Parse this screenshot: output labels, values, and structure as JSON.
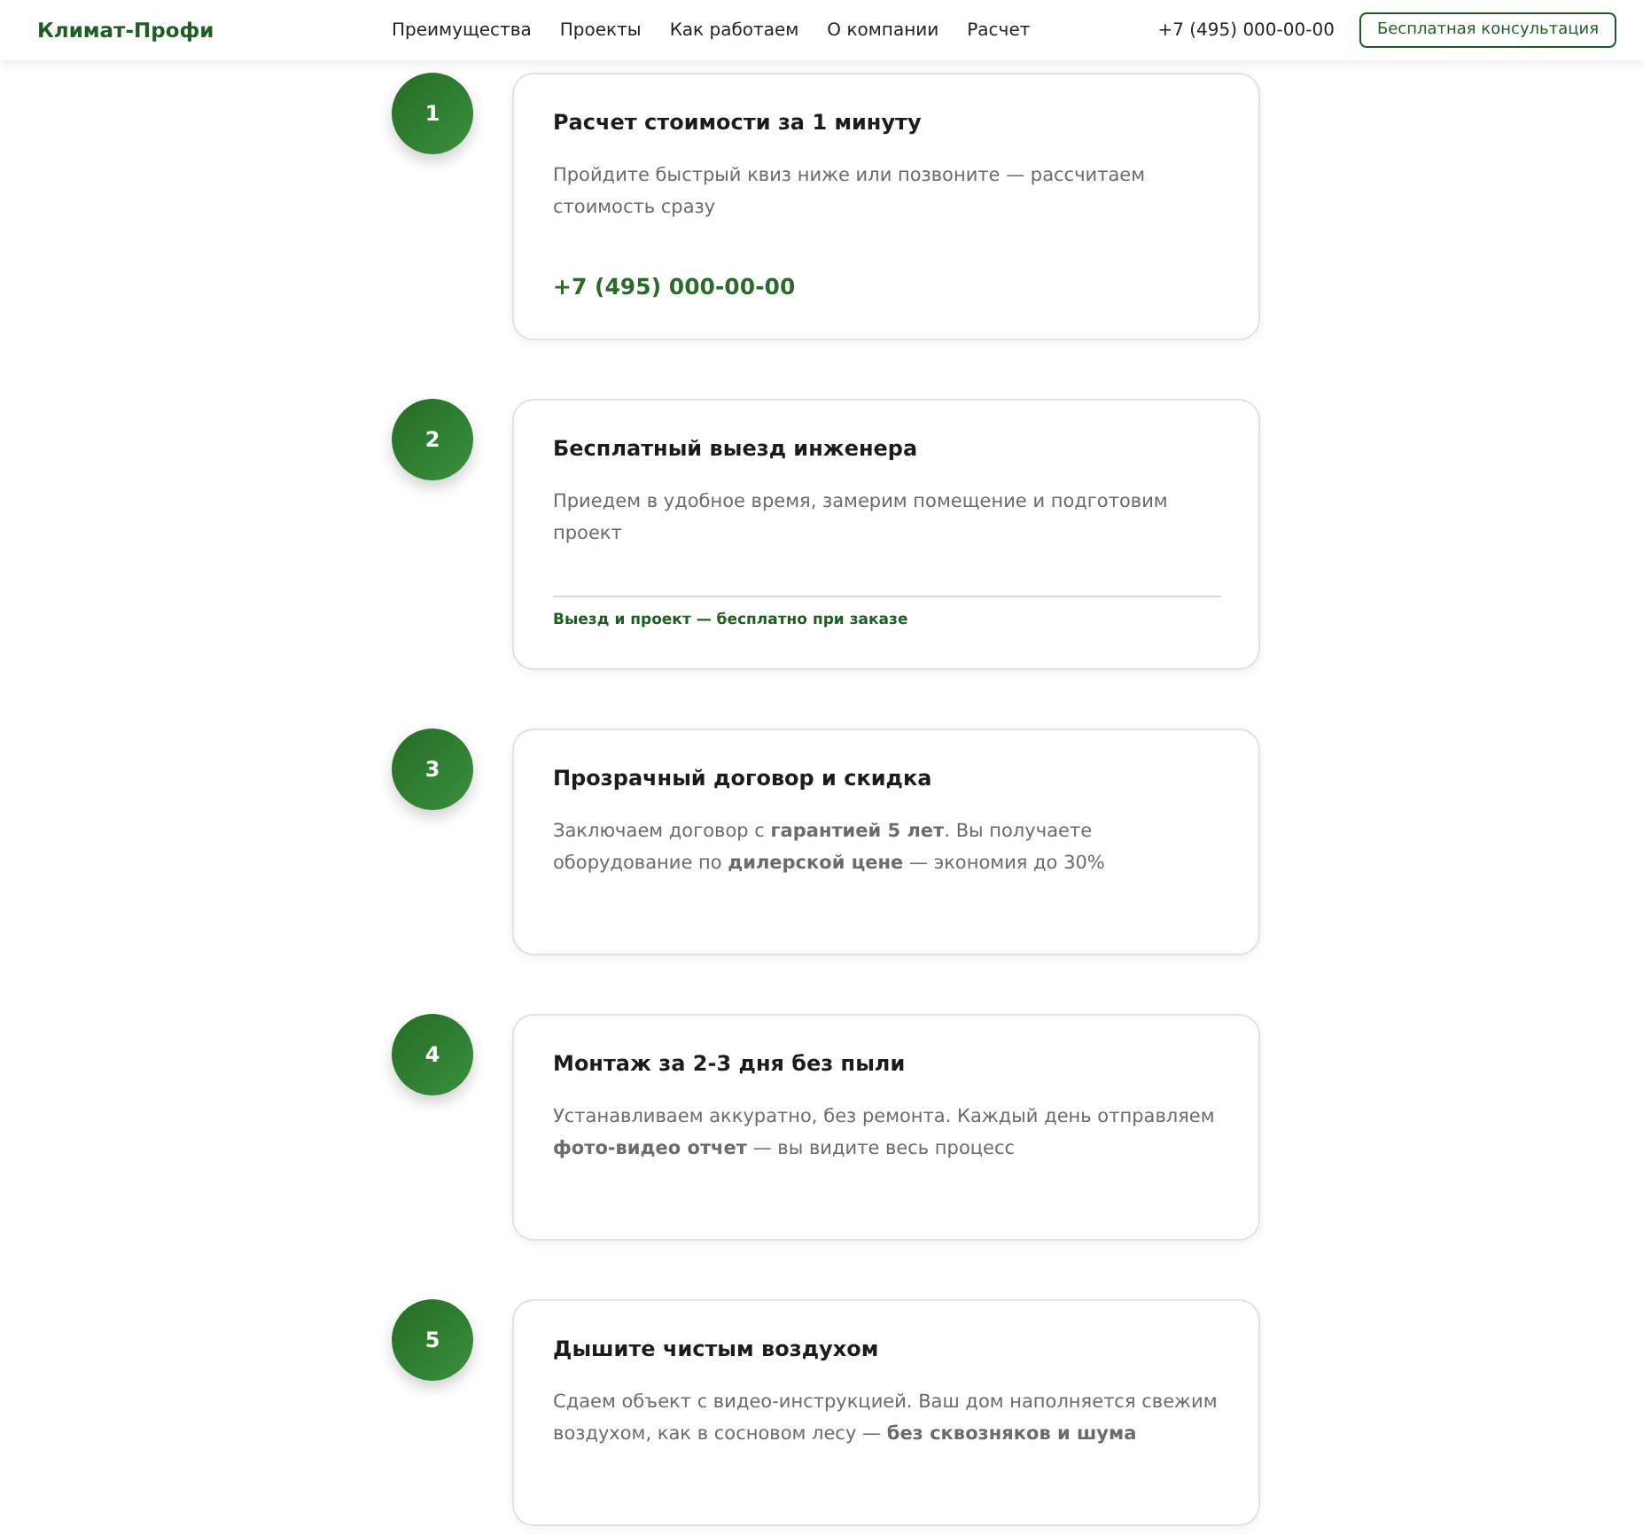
{
  "header": {
    "logo": "Климат-Профи",
    "nav": [
      "Преимущества",
      "Проекты",
      "Как работаем",
      "О компании",
      "Расчет"
    ],
    "phone": "+7 (495) 000-00-00",
    "cta": "Бесплатная консультация"
  },
  "steps": [
    {
      "number": "1",
      "title": "Расчет стоимости за 1 минуту",
      "text": "Пройдите быстрый квиз ниже или позвоните — рассчитаем стоимость сразу",
      "extra": {
        "kind": "phone",
        "text": "+7 (495) 000-00-00"
      }
    },
    {
      "number": "2",
      "title": "Бесплатный выезд инженера",
      "text": "Приедем в удобное время, замерим помещение и подготовим проект",
      "extra": {
        "kind": "note",
        "text": "Выезд и проект — бесплатно при заказе"
      }
    },
    {
      "number": "3",
      "title": "Прозрачный договор и скидка",
      "text": "Заключаем договор с **гарантией 5 лет**. Вы получаете оборудование по **дилерской цене** — экономия до 30%"
    },
    {
      "number": "4",
      "title": "Монтаж за 2-3 дня без пыли",
      "text": "Устанавливаем аккуратно, без ремонта. Каждый день отправляем **фото-видео отчет** — вы видите весь процесс"
    },
    {
      "number": "5",
      "title": "Дышите чистым воздухом",
      "text": "Сдаем объект с видео-инструкцией. Ваш дом наполняется свежим воздухом, как в сосновом лесу — **без сквозняков и шума**"
    }
  ]
}
